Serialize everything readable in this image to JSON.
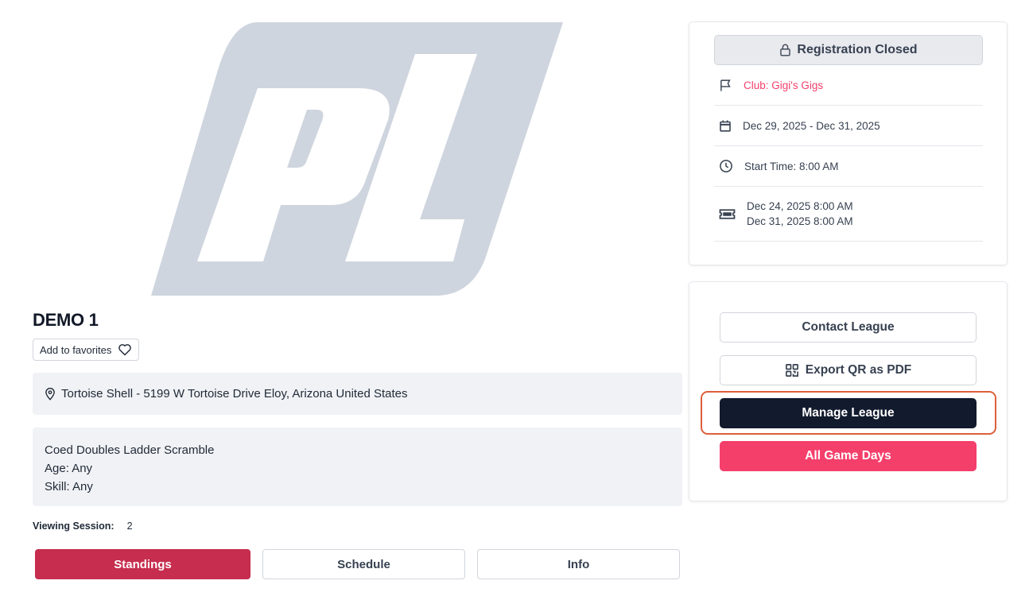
{
  "brand": {
    "logo_text": "PL",
    "logo_color": "#cfd5de"
  },
  "league": {
    "title": "DEMO 1",
    "favorites_label": "Add to favorites",
    "location": "Tortoise Shell - 5199 W Tortoise Drive Eloy, Arizona United States",
    "description": {
      "format": "Coed Doubles Ladder Scramble",
      "age": "Age: Any",
      "skill": "Skill: Any"
    },
    "viewing_session_label": "Viewing Session:",
    "viewing_session_value": "2"
  },
  "tabs": [
    {
      "label": "Standings",
      "active": true
    },
    {
      "label": "Schedule",
      "active": false
    },
    {
      "label": "Info",
      "active": false
    }
  ],
  "info_card": {
    "registration_status": "Registration Closed",
    "club": "Club: Gigi's Gigs",
    "dates": "Dec 29, 2025 - Dec 31, 2025",
    "start_time": "Start Time: 8:00 AM",
    "registration_open": "Dec 24, 2025 8:00 AM",
    "registration_close": "Dec 31, 2025 8:00 AM"
  },
  "actions": {
    "contact": "Contact League",
    "export_qr": "Export QR as PDF",
    "manage": "Manage League",
    "game_days": "All Game Days"
  },
  "colors": {
    "primary_red": "#c62d4e",
    "accent_pink": "#f43f6b",
    "dark_navy": "#121a2d",
    "panel_gray": "#f1f2f5",
    "highlight_orange": "#dc5f3b"
  },
  "icons": [
    "map-pin-icon",
    "heart-icon",
    "lock-icon",
    "flag-icon",
    "calendar-icon",
    "clock-icon",
    "ticket-icon",
    "qr-code-icon"
  ]
}
